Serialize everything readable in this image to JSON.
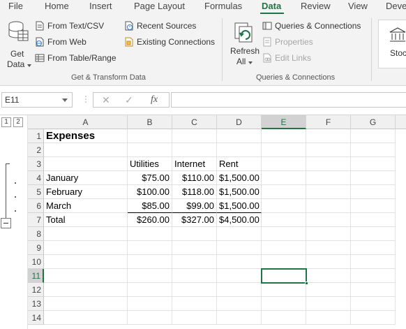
{
  "menu": {
    "tabs": [
      {
        "label": "File"
      },
      {
        "label": "Home"
      },
      {
        "label": "Insert"
      },
      {
        "label": "Page Layout"
      },
      {
        "label": "Formulas"
      },
      {
        "label": "Data"
      },
      {
        "label": "Review"
      },
      {
        "label": "View"
      },
      {
        "label": "Deve"
      }
    ],
    "active": "Data"
  },
  "ribbon": {
    "get_transform": {
      "get_data_label_1": "Get",
      "get_data_label_2": "Data",
      "from_text_csv": "From Text/CSV",
      "from_web": "From Web",
      "from_table_range": "From Table/Range",
      "recent_sources": "Recent Sources",
      "existing_connections": "Existing Connections",
      "group_label": "Get & Transform Data"
    },
    "queries": {
      "refresh_label_1": "Refresh",
      "refresh_label_2": "All",
      "queries_connections": "Queries & Connections",
      "properties": "Properties",
      "edit_links": "Edit Links",
      "group_label": "Queries & Connections"
    },
    "stocks": {
      "label": "Stoc"
    }
  },
  "formula_bar": {
    "name_box": "E11",
    "cancel": "✕",
    "enter": "✓",
    "fx": "fx",
    "formula": ""
  },
  "outline": {
    "levels": [
      "1",
      "2"
    ]
  },
  "columns": [
    "A",
    "B",
    "C",
    "D",
    "E",
    "F",
    "G"
  ],
  "selected": {
    "column": "E",
    "row": "11"
  },
  "rows": [
    {
      "num": "1",
      "A": "Expenses",
      "B": "",
      "C": "",
      "D": ""
    },
    {
      "num": "2",
      "A": "",
      "B": "",
      "C": "",
      "D": ""
    },
    {
      "num": "3",
      "A": "",
      "B": "Utilities",
      "C": "Internet",
      "D": "Rent"
    },
    {
      "num": "4",
      "A": "January",
      "B": "$75.00",
      "C": "$110.00",
      "D": "$1,500.00"
    },
    {
      "num": "5",
      "A": "February",
      "B": "$100.00",
      "C": "$118.00",
      "D": "$1,500.00"
    },
    {
      "num": "6",
      "A": "March",
      "B": "$85.00",
      "C": "$99.00",
      "D": "$1,500.00"
    },
    {
      "num": "7",
      "A": "Total",
      "B": "$260.00",
      "C": "$327.00",
      "D": "$4,500.00"
    },
    {
      "num": "8",
      "A": "",
      "B": "",
      "C": "",
      "D": ""
    },
    {
      "num": "9",
      "A": "",
      "B": "",
      "C": "",
      "D": ""
    },
    {
      "num": "10",
      "A": "",
      "B": "",
      "C": "",
      "D": ""
    },
    {
      "num": "11",
      "A": "",
      "B": "",
      "C": "",
      "D": ""
    },
    {
      "num": "12",
      "A": "",
      "B": "",
      "C": "",
      "D": ""
    },
    {
      "num": "13",
      "A": "",
      "B": "",
      "C": "",
      "D": ""
    },
    {
      "num": "14",
      "A": "",
      "B": "",
      "C": "",
      "D": ""
    }
  ],
  "colors": {
    "accent": "#217346"
  }
}
